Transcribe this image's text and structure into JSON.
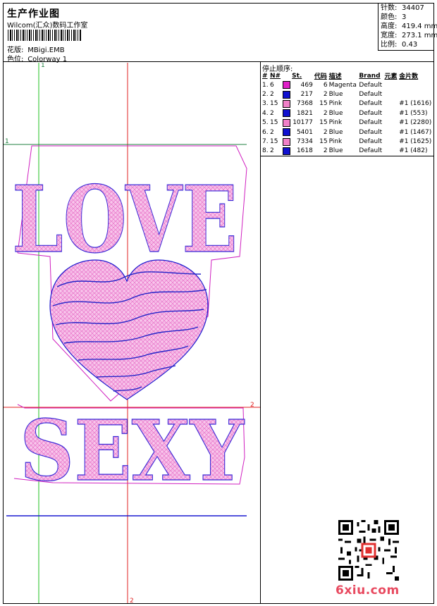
{
  "header": {
    "title": "生产作业图",
    "company": "Wilcom(汇众)数码工作室",
    "design_label": "花版:",
    "design_value": "MBigi.EMB",
    "colorway_label": "色位:",
    "colorway_value": "Colorway 1"
  },
  "stats": [
    {
      "label": "针数:",
      "value": "34407"
    },
    {
      "label": "颜色:",
      "value": "3"
    },
    {
      "label": "高度:",
      "value": "419.4 mm"
    },
    {
      "label": "宽度:",
      "value": "273.1 mm"
    },
    {
      "label": "比例:",
      "value": "0.43"
    }
  ],
  "sequence": {
    "heading": "停止顺序:",
    "columns": [
      "#",
      "N#",
      "",
      "St.",
      "代码",
      "描述",
      "Brand",
      "元素",
      "金片数"
    ],
    "rows": [
      {
        "idx": "1.",
        "n": "6",
        "color": "#e020c8",
        "st": "469",
        "code": "6",
        "desc": "Magenta",
        "brand": "Default",
        "elem": "",
        "sequin": ""
      },
      {
        "idx": "2.",
        "n": "2",
        "color": "#1010d0",
        "st": "217",
        "code": "2",
        "desc": "Blue",
        "brand": "Default",
        "elem": "",
        "sequin": ""
      },
      {
        "idx": "3.",
        "n": "15",
        "color": "#f080c8",
        "st": "7368",
        "code": "15",
        "desc": "Pink",
        "brand": "Default",
        "elem": "",
        "sequin": "#1 (1616)"
      },
      {
        "idx": "4.",
        "n": "2",
        "color": "#1010d0",
        "st": "1821",
        "code": "2",
        "desc": "Blue",
        "brand": "Default",
        "elem": "",
        "sequin": "#1 (553)"
      },
      {
        "idx": "5.",
        "n": "15",
        "color": "#f080c8",
        "st": "10177",
        "code": "15",
        "desc": "Pink",
        "brand": "Default",
        "elem": "",
        "sequin": "#1 (2280)"
      },
      {
        "idx": "6.",
        "n": "2",
        "color": "#1010d0",
        "st": "5401",
        "code": "2",
        "desc": "Blue",
        "brand": "Default",
        "elem": "",
        "sequin": "#1 (1467)"
      },
      {
        "idx": "7.",
        "n": "15",
        "color": "#f080c8",
        "st": "7334",
        "code": "15",
        "desc": "Pink",
        "brand": "Default",
        "elem": "",
        "sequin": "#1 (1625)"
      },
      {
        "idx": "8.",
        "n": "2",
        "color": "#1010d0",
        "st": "1618",
        "code": "2",
        "desc": "Blue",
        "brand": "Default",
        "elem": "",
        "sequin": "#1 (482)"
      }
    ]
  },
  "design": {
    "word_top": "LOVE",
    "word_bottom": "SEXY",
    "guide_markers": {
      "top_left": "1",
      "left": "1",
      "mid_right": "2",
      "bottom": "2"
    },
    "colors": {
      "pink": "#f07cd0",
      "blue": "#1a1ad0",
      "magenta": "#d020c0",
      "green": "#20c020",
      "red": "#e02020"
    }
  },
  "watermark": "6xiu.com"
}
